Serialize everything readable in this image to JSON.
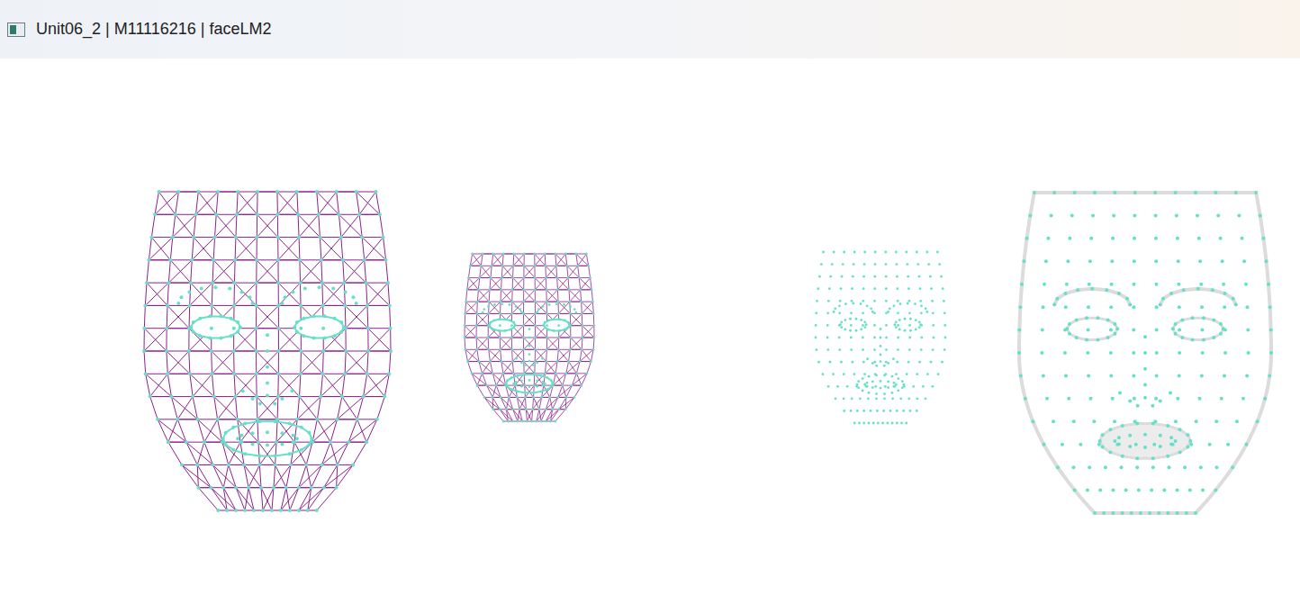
{
  "window": {
    "title": "Unit06_2 | M11116216 | faceLM2"
  },
  "faces": [
    {
      "kind": "mesh"
    },
    {
      "kind": "mesh"
    },
    {
      "kind": "points"
    },
    {
      "kind": "contour"
    }
  ]
}
